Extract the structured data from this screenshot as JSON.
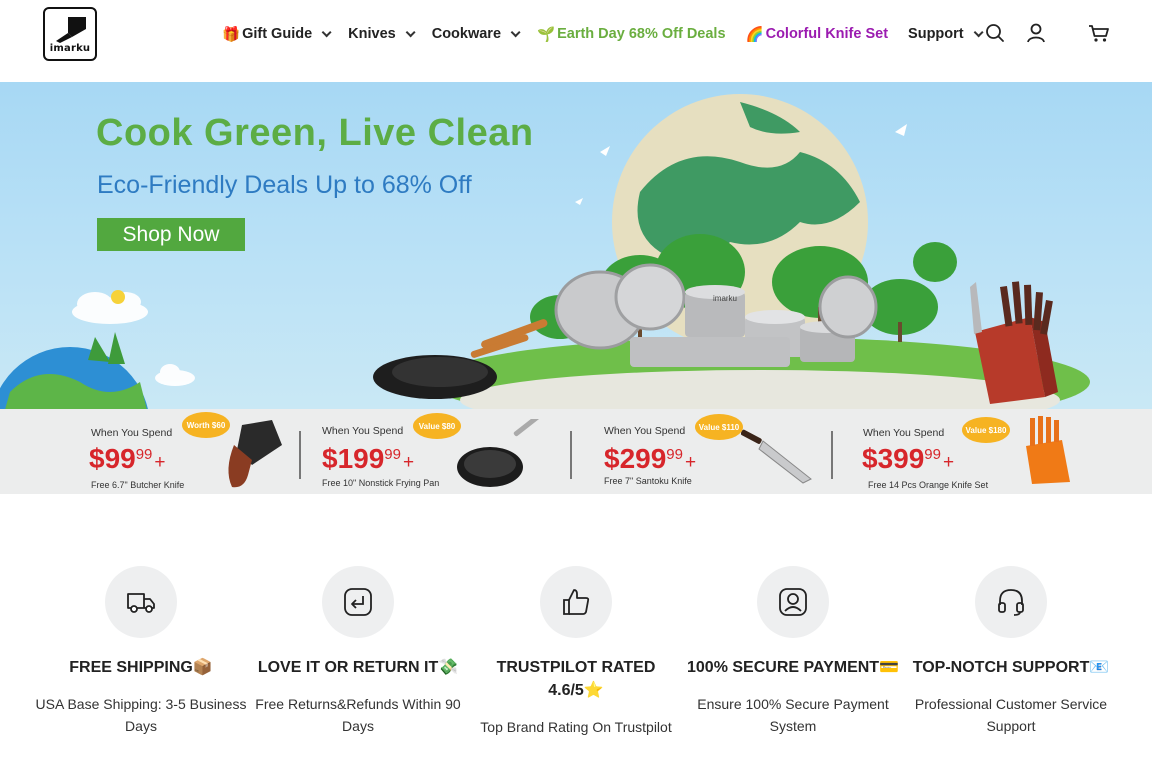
{
  "header": {
    "logo_text": "imarku",
    "nav": [
      {
        "emoji": "🎁",
        "label": "Gift Guide",
        "dropdown": true
      },
      {
        "emoji": "",
        "label": "Knives",
        "dropdown": true
      },
      {
        "emoji": "",
        "label": "Cookware",
        "dropdown": true
      },
      {
        "emoji": "🌱",
        "label": "Earth Day 68% Off Deals",
        "dropdown": false
      },
      {
        "emoji": "🌈",
        "label": "Colorful Knife Set",
        "dropdown": false
      },
      {
        "emoji": "",
        "label": "Support",
        "dropdown": true
      }
    ],
    "icons": [
      "search-icon",
      "account-icon",
      "cart-icon"
    ]
  },
  "hero": {
    "title": "Cook Green, Live Clean",
    "subtitle": "Eco-Friendly Deals Up to 68% Off",
    "cta": "Shop Now",
    "pan_brand": "imarku"
  },
  "promos": [
    {
      "spend_label": "When You Spend",
      "price": "$99",
      "cents": "99",
      "plus": "+",
      "badge": "Worth $60",
      "gift": "Free 6.7\" Butcher Knife"
    },
    {
      "spend_label": "When You Spend",
      "price": "$199",
      "cents": "99",
      "plus": "+",
      "badge": "Value $80",
      "gift": "Free 10\" Nonstick Frying Pan"
    },
    {
      "spend_label": "When You Spend",
      "price": "$299",
      "cents": "99",
      "plus": "+",
      "badge": "Value $110",
      "gift": "Free 7\" Santoku Knife"
    },
    {
      "spend_label": "When You Spend",
      "price": "$399",
      "cents": "99",
      "plus": "+",
      "badge": "Value $180",
      "gift": "Free 14 Pcs Orange Knife Set"
    }
  ],
  "features": [
    {
      "icon": "truck-icon",
      "title": "FREE SHIPPING📦",
      "desc": "USA Base Shipping: 3-5 Business Days"
    },
    {
      "icon": "return-icon",
      "title": "LOVE IT OR RETURN IT💸",
      "desc": "Free Returns&Refunds Within 90 Days"
    },
    {
      "icon": "thumbs-up-icon",
      "title": "TRUSTPILOT RATED 4.6/5⭐",
      "desc": "Top Brand Rating On Trustpilot"
    },
    {
      "icon": "secure-payment-icon",
      "title": "100% SECURE PAYMENT💳",
      "desc": "Ensure 100% Secure Payment System"
    },
    {
      "icon": "headset-icon",
      "title": "TOP-NOTCH SUPPORT📧",
      "desc": "Professional Customer Service Support"
    }
  ],
  "colors": {
    "brand_green": "#5cad45",
    "button_green": "#52a83f",
    "subtitle_blue": "#2e7bc2",
    "price_red": "#d7262b",
    "nav_green": "#6aae3f",
    "nav_purple": "#9b1bb0"
  }
}
